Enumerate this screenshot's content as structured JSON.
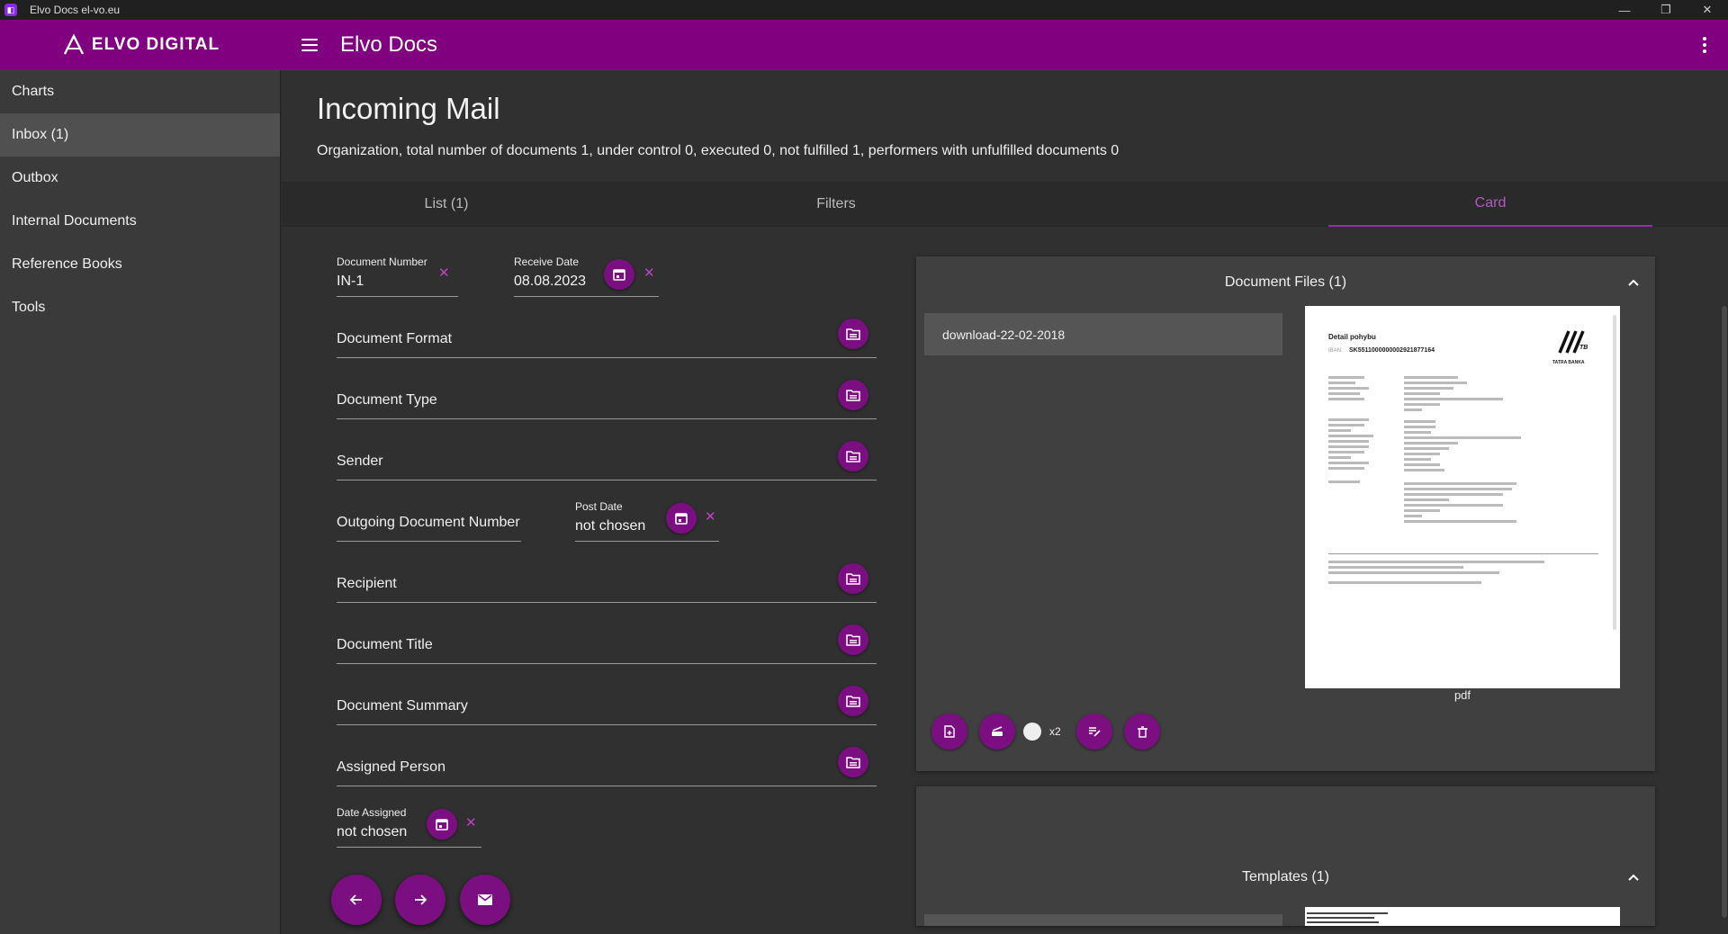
{
  "window": {
    "title": "Elvo Docs el-vo.eu",
    "controls": [
      "—",
      "❐",
      "✕"
    ]
  },
  "appbar": {
    "brand": "ELVO DIGITAL",
    "app_name": "Elvo Docs"
  },
  "sidebar": {
    "items": [
      {
        "label": "Charts",
        "active": false
      },
      {
        "label": "Inbox (1)",
        "active": true
      },
      {
        "label": "Outbox",
        "active": false
      },
      {
        "label": "Internal Documents",
        "active": false
      },
      {
        "label": "Reference Books",
        "active": false
      },
      {
        "label": "Tools",
        "active": false
      }
    ]
  },
  "page": {
    "title": "Incoming Mail",
    "summary": "Organization,  total number of documents 1, under control 0, executed 0, not fulfilled 1, performers with unfulfilled documents 0"
  },
  "tabs": [
    {
      "label": "List (1)",
      "active": false
    },
    {
      "label": "Filters",
      "active": false
    },
    {
      "label": "Card",
      "active": true
    }
  ],
  "form": {
    "document_number": {
      "label": "Document Number",
      "value": "IN-1"
    },
    "receive_date": {
      "label": "Receive Date",
      "value": "08.08.2023"
    },
    "document_format": {
      "label": "Document Format"
    },
    "document_type": {
      "label": "Document Type"
    },
    "sender": {
      "label": "Sender"
    },
    "outgoing_number": {
      "label": "Outgoing Document Number"
    },
    "post_date": {
      "label": "Post Date",
      "value": "not chosen"
    },
    "recipient": {
      "label": "Recipient"
    },
    "document_title": {
      "label": "Document Title"
    },
    "document_summary": {
      "label": "Document Summary"
    },
    "assigned_person": {
      "label": "Assigned Person"
    },
    "date_assigned": {
      "label": "Date Assigned",
      "value": "not chosen"
    },
    "clear_glyph": "✕"
  },
  "files_panel": {
    "title": "Document Files (1)",
    "file_name": "download-22-02-2018",
    "file_type": "pdf",
    "zoom_label": "x2",
    "preview": {
      "heading": "Detail pohybu",
      "iban_label": "IBAN:",
      "iban": "SK5511000000002921877164",
      "bank": "TATRA BANKA",
      "bank_mark": "TB"
    }
  },
  "templates_panel": {
    "title": "Templates (1)"
  },
  "colors": {
    "accent": "#800080",
    "button": "#7b0f82",
    "active_tab": "#b05bc0"
  }
}
